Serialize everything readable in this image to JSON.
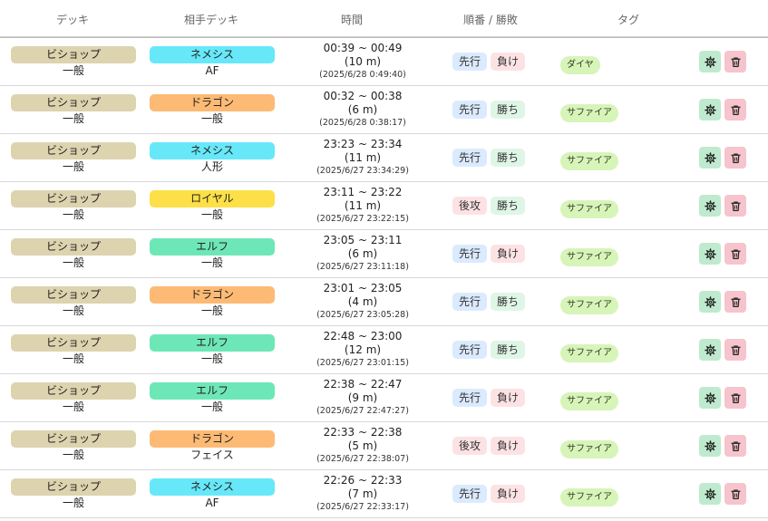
{
  "headers": {
    "deck": "デッキ",
    "opponent": "相手デッキ",
    "time": "時間",
    "order_result": "順番 / 勝敗",
    "tag": "タグ"
  },
  "class_colors": {
    "ビショップ": "#ddd3ae",
    "ネメシス": "#67e8f9",
    "ドラゴン": "#fdba74",
    "ロイヤル": "#fde047",
    "エルフ": "#6ee7b7"
  },
  "icons": {
    "settings": "gear-icon",
    "delete": "trash-icon"
  },
  "rows": [
    {
      "deck": "ビショップ",
      "deck_sub": "一般",
      "opp": "ネメシス",
      "opp_sub": "AF",
      "range": "00:39 ~ 00:49",
      "duration": "(10 m)",
      "stamp": "(2025/6/28 0:49:40)",
      "order": "先行",
      "result": "負け",
      "tag": "ダイヤ"
    },
    {
      "deck": "ビショップ",
      "deck_sub": "一般",
      "opp": "ドラゴン",
      "opp_sub": "一般",
      "range": "00:32 ~ 00:38",
      "duration": "(6 m)",
      "stamp": "(2025/6/28 0:38:17)",
      "order": "先行",
      "result": "勝ち",
      "tag": "サファイア"
    },
    {
      "deck": "ビショップ",
      "deck_sub": "一般",
      "opp": "ネメシス",
      "opp_sub": "人形",
      "range": "23:23 ~ 23:34",
      "duration": "(11 m)",
      "stamp": "(2025/6/27 23:34:29)",
      "order": "先行",
      "result": "勝ち",
      "tag": "サファイア"
    },
    {
      "deck": "ビショップ",
      "deck_sub": "一般",
      "opp": "ロイヤル",
      "opp_sub": "一般",
      "range": "23:11 ~ 23:22",
      "duration": "(11 m)",
      "stamp": "(2025/6/27 23:22:15)",
      "order": "後攻",
      "result": "勝ち",
      "tag": "サファイア"
    },
    {
      "deck": "ビショップ",
      "deck_sub": "一般",
      "opp": "エルフ",
      "opp_sub": "一般",
      "range": "23:05 ~ 23:11",
      "duration": "(6 m)",
      "stamp": "(2025/6/27 23:11:18)",
      "order": "先行",
      "result": "負け",
      "tag": "サファイア"
    },
    {
      "deck": "ビショップ",
      "deck_sub": "一般",
      "opp": "ドラゴン",
      "opp_sub": "一般",
      "range": "23:01 ~ 23:05",
      "duration": "(4 m)",
      "stamp": "(2025/6/27 23:05:28)",
      "order": "先行",
      "result": "勝ち",
      "tag": "サファイア"
    },
    {
      "deck": "ビショップ",
      "deck_sub": "一般",
      "opp": "エルフ",
      "opp_sub": "一般",
      "range": "22:48 ~ 23:00",
      "duration": "(12 m)",
      "stamp": "(2025/6/27 23:01:15)",
      "order": "先行",
      "result": "勝ち",
      "tag": "サファイア"
    },
    {
      "deck": "ビショップ",
      "deck_sub": "一般",
      "opp": "エルフ",
      "opp_sub": "一般",
      "range": "22:38 ~ 22:47",
      "duration": "(9 m)",
      "stamp": "(2025/6/27 22:47:27)",
      "order": "先行",
      "result": "負け",
      "tag": "サファイア"
    },
    {
      "deck": "ビショップ",
      "deck_sub": "一般",
      "opp": "ドラゴン",
      "opp_sub": "フェイス",
      "range": "22:33 ~ 22:38",
      "duration": "(5 m)",
      "stamp": "(2025/6/27 22:38:07)",
      "order": "後攻",
      "result": "負け",
      "tag": "サファイア"
    },
    {
      "deck": "ビショップ",
      "deck_sub": "一般",
      "opp": "ネメシス",
      "opp_sub": "AF",
      "range": "22:26 ~ 22:33",
      "duration": "(7 m)",
      "stamp": "(2025/6/27 22:33:17)",
      "order": "先行",
      "result": "負け",
      "tag": "サファイア"
    }
  ]
}
